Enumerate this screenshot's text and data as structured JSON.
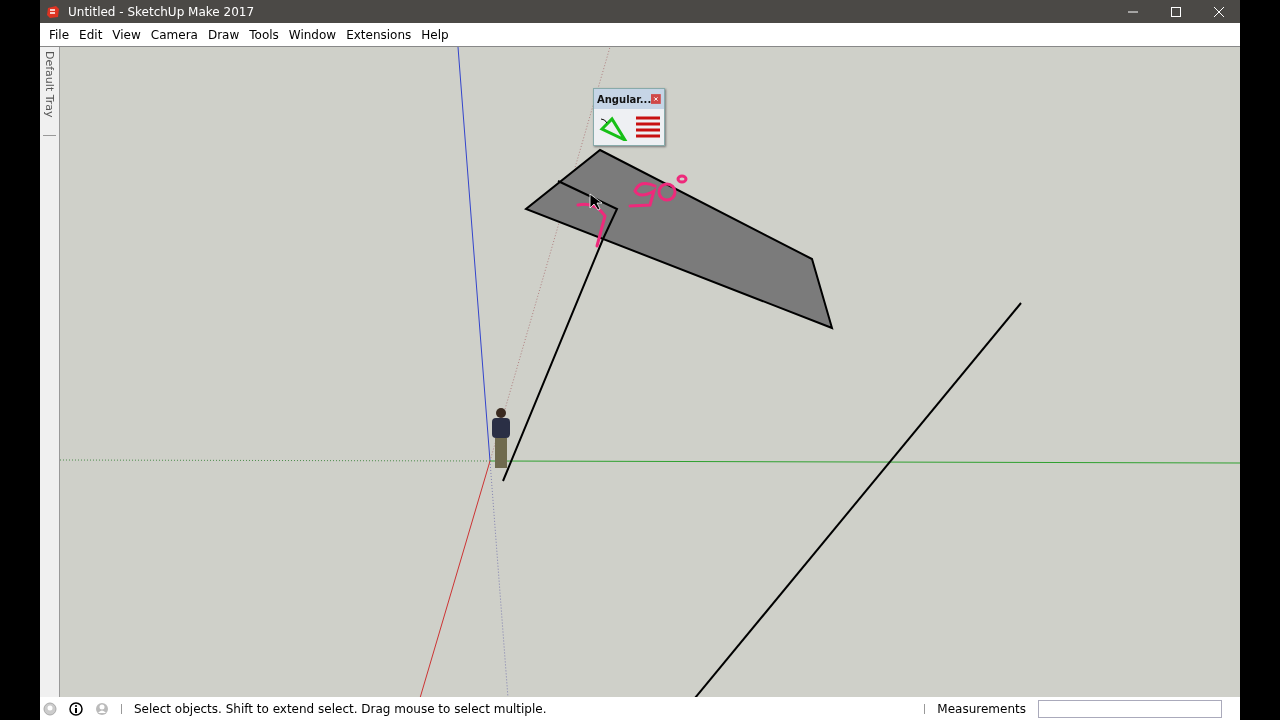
{
  "window": {
    "title": "Untitled - SketchUp Make 2017"
  },
  "menu": [
    "File",
    "Edit",
    "View",
    "Camera",
    "Draw",
    "Tools",
    "Window",
    "Extensions",
    "Help"
  ],
  "tray": {
    "label": "Default Tray"
  },
  "toolbar": {
    "title": "Angular..."
  },
  "status_bar": {
    "message": "Select objects. Shift to extend select. Drag mouse to select multiple.",
    "measurements_label": "Measurements"
  }
}
